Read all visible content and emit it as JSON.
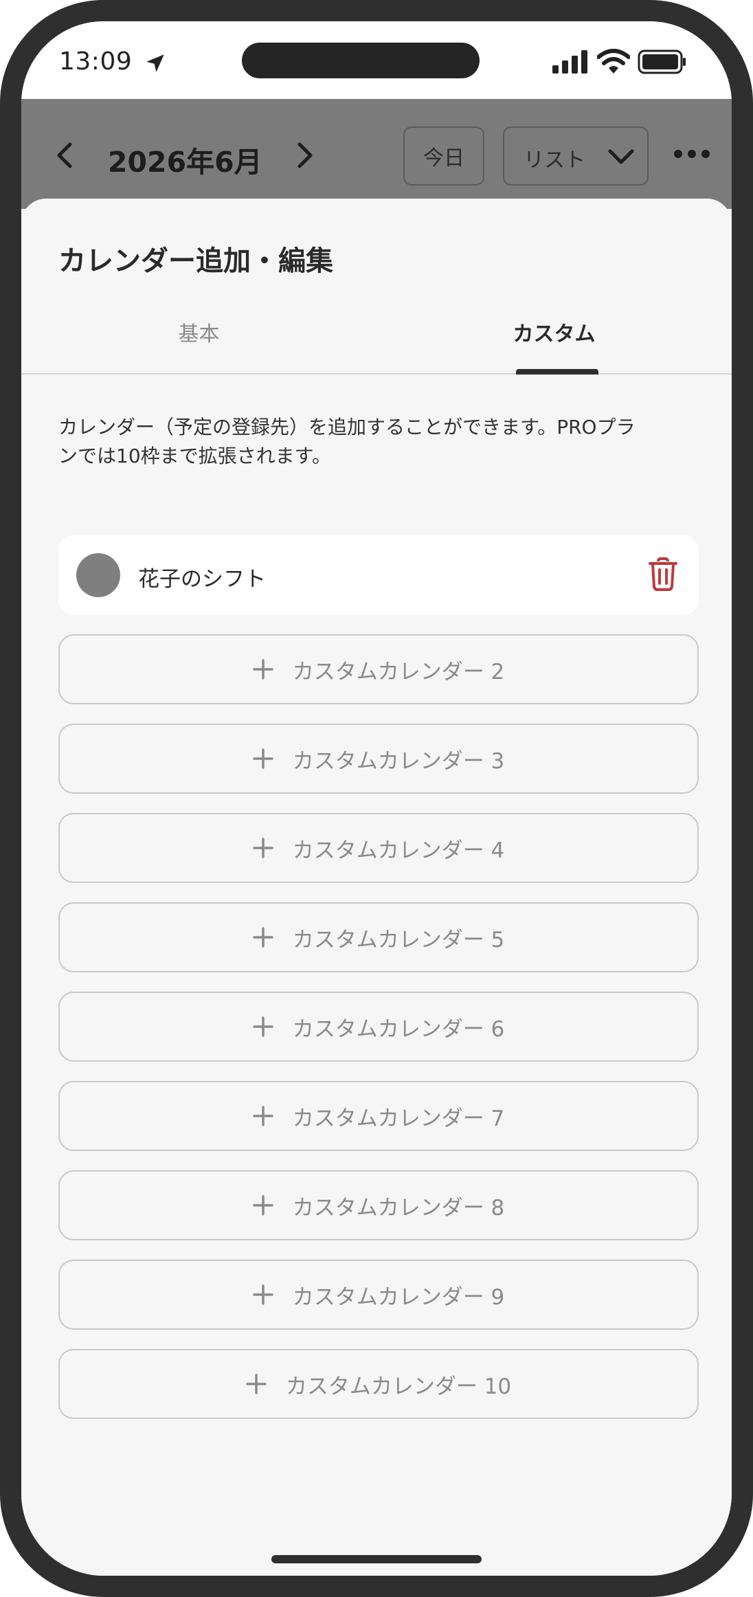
{
  "status_bar": {
    "time": "13:09"
  },
  "header": {
    "month": "2026年6月",
    "today_label": "今日",
    "view_label": "リスト"
  },
  "sheet": {
    "title": "カレンダー追加・編集",
    "tabs": [
      {
        "label": "基本",
        "active": false
      },
      {
        "label": "カスタム",
        "active": true
      }
    ],
    "description_line1": "カレンダー（予定の登録先）を追加することができます。PROプラ",
    "description_line2": "ンでは10枠まで拡張されます。",
    "calendars": [
      {
        "name": "花子のシフト",
        "color": "#7f7f7f"
      }
    ],
    "add_buttons": [
      "カスタムカレンダー 2",
      "カスタムカレンダー 3",
      "カスタムカレンダー 4",
      "カスタムカレンダー 5",
      "カスタムカレンダー 6",
      "カスタムカレンダー 7",
      "カスタムカレンダー 8",
      "カスタムカレンダー 9",
      "カスタムカレンダー 10"
    ]
  },
  "colors": {
    "delete_icon": "#c0393b",
    "dimmed_header": "#7b7b7b",
    "sheet_background": "#f6f6f6"
  },
  "icons": {
    "location": "location-arrow-icon",
    "signal": "cellular-signal-icon",
    "wifi": "wifi-icon",
    "battery": "battery-icon",
    "prev": "chevron-left-icon",
    "next": "chevron-right-icon",
    "dropdown": "chevron-down-icon",
    "more": "more-dots-icon",
    "delete": "trash-icon",
    "add": "plus-icon"
  }
}
